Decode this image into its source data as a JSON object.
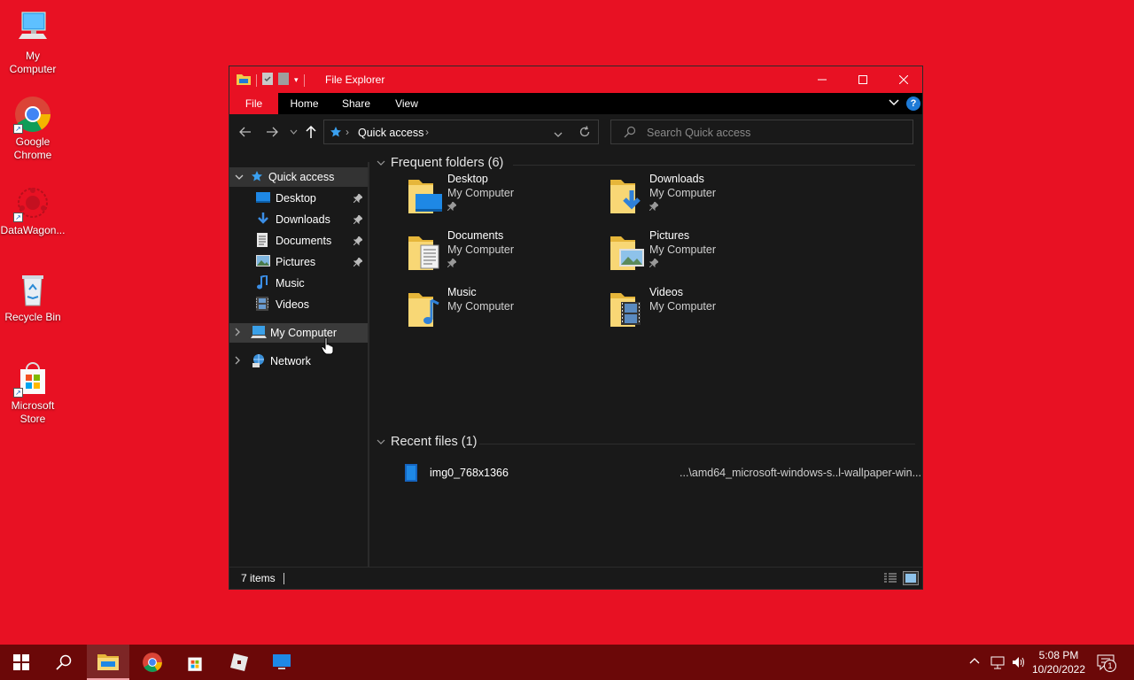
{
  "desktop": {
    "icons": [
      {
        "label": "My\nComputer",
        "icon": "computer-icon"
      },
      {
        "label": "Google\nChrome",
        "icon": "chrome-icon"
      },
      {
        "label": "DataWagon...",
        "icon": "datawagon-icon"
      },
      {
        "label": "Recycle Bin",
        "icon": "recycle-bin-icon"
      },
      {
        "label": "Microsoft\nStore",
        "icon": "store-icon"
      }
    ]
  },
  "window": {
    "title": "File Explorer",
    "ribbon_tabs": [
      "File",
      "Home",
      "Share",
      "View"
    ],
    "address": {
      "breadcrumb": "Quick access"
    },
    "search": {
      "placeholder": "Search Quick access"
    },
    "status": {
      "items": "7 items"
    }
  },
  "nav": {
    "quick_access": "Quick access",
    "items": [
      {
        "label": "Desktop",
        "pinned": true,
        "icon": "desktop-icon"
      },
      {
        "label": "Downloads",
        "pinned": true,
        "icon": "downloads-icon"
      },
      {
        "label": "Documents",
        "pinned": true,
        "icon": "documents-icon"
      },
      {
        "label": "Pictures",
        "pinned": true,
        "icon": "pictures-icon"
      },
      {
        "label": "Music",
        "pinned": false,
        "icon": "music-icon"
      },
      {
        "label": "Videos",
        "pinned": false,
        "icon": "videos-icon"
      }
    ],
    "my_computer": "My Computer",
    "network": "Network"
  },
  "content": {
    "frequent_header": "Frequent folders (6)",
    "folders": [
      {
        "name": "Desktop",
        "location": "My Computer",
        "pinned": true
      },
      {
        "name": "Downloads",
        "location": "My Computer",
        "pinned": true
      },
      {
        "name": "Documents",
        "location": "My Computer",
        "pinned": true
      },
      {
        "name": "Pictures",
        "location": "My Computer",
        "pinned": true
      },
      {
        "name": "Music",
        "location": "My Computer",
        "pinned": false
      },
      {
        "name": "Videos",
        "location": "My Computer",
        "pinned": false
      }
    ],
    "recent_header": "Recent files (1)",
    "recent": [
      {
        "name": "img0_768x1366",
        "path": "...\\amd64_microsoft-windows-s..l-wallpaper-win..."
      }
    ]
  },
  "taskbar": {
    "time": "5:08 PM",
    "date": "10/20/2022",
    "notifications": "1"
  },
  "colors": {
    "accent": "#e81123",
    "taskbar": "#6b0808",
    "window_bg": "#191919"
  }
}
